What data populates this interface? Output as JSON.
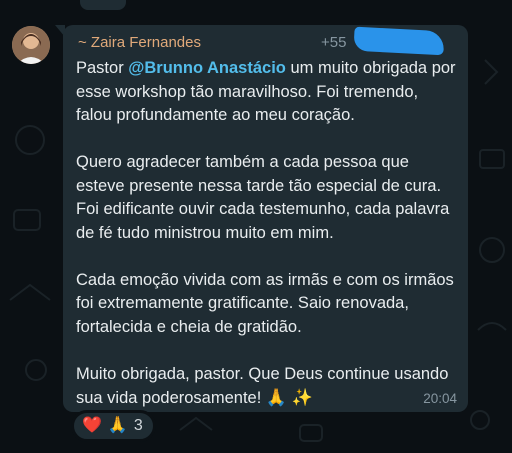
{
  "chat": {
    "sender": "~ Zaira Fernandes",
    "phone_partial": "+55",
    "time": "20:04",
    "mention": "@Brunno Anastácio",
    "paragraphs": [
      "um muito obrigada por esse workshop tão maravilhoso. Foi tremendo, falou profundamente ao meu coração.",
      "Quero agradecer também a cada pessoa que esteve presente nessa tarde tão especial de cura. Foi edificante ouvir cada testemunho, cada palavra de fé  tudo ministrou muito em mim.",
      "Cada emoção vivida com as irmãs e com os irmãos foi extremamente gratificante. Saio renovada, fortalecida e cheia de gratidão.",
      "Muito obrigada, pastor. Que Deus continue usando sua vida poderosamente!"
    ],
    "first_paragraph_prefix": "Pastor",
    "closing_emojis": "🙏 ✨",
    "reactions": {
      "heart": "❤️",
      "pray": "🙏",
      "count": "3"
    }
  },
  "colors": {
    "background": "#0b1014",
    "bubble": "#1f2c33",
    "sender": "#e0a97a",
    "mention": "#53bdeb",
    "text": "#e9edef",
    "meta": "#8696a0",
    "mask": "#2a93ea"
  }
}
